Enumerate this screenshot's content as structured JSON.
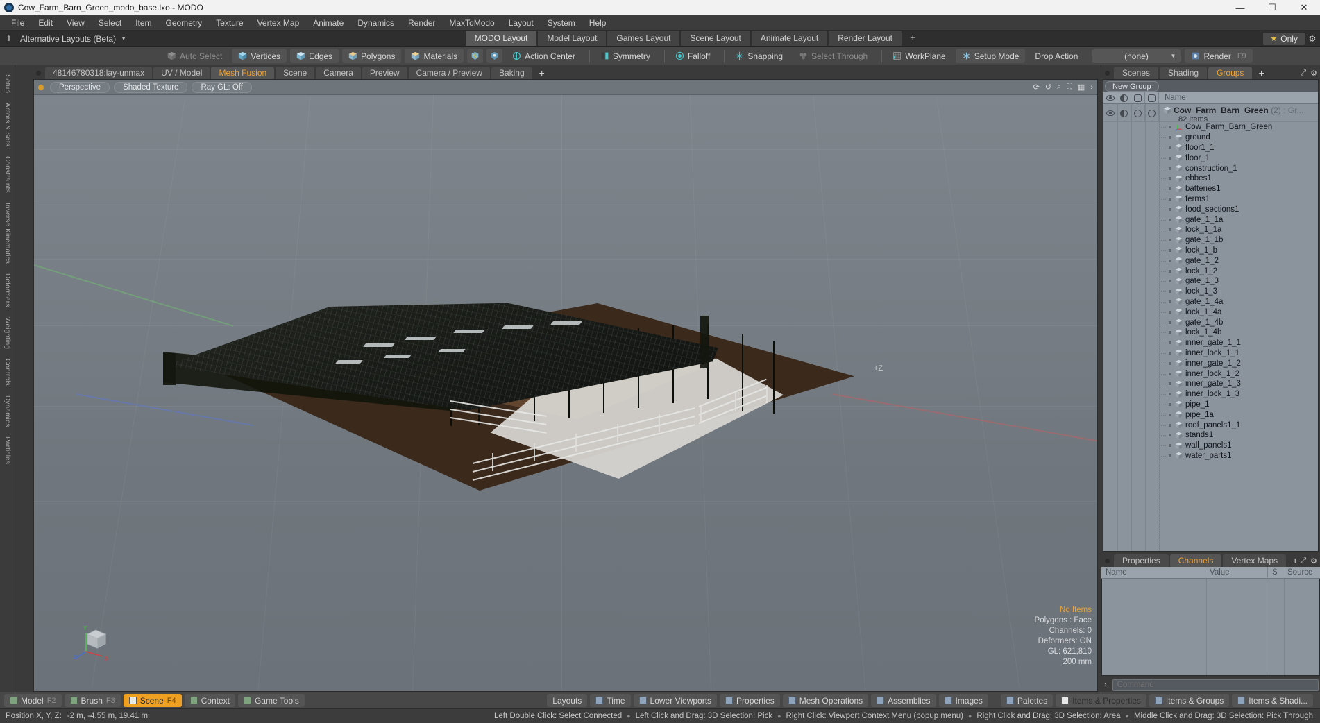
{
  "titlebar": {
    "title": "Cow_Farm_Barn_Green_modo_base.lxo - MODO",
    "app_icon": "modo-logo-icon",
    "minimize": "—",
    "maximize": "☐",
    "close": "✕"
  },
  "menubar": {
    "items": [
      "File",
      "Edit",
      "View",
      "Select",
      "Item",
      "Geometry",
      "Texture",
      "Vertex Map",
      "Animate",
      "Dynamics",
      "Render",
      "MaxToModo",
      "Layout",
      "System",
      "Help"
    ]
  },
  "layoutbar": {
    "alt_layouts": "Alternative Layouts (Beta)",
    "caret": "▼",
    "tabs": [
      {
        "label": "MODO Layout",
        "active": true
      },
      {
        "label": "Model Layout",
        "active": false
      },
      {
        "label": "Games Layout",
        "active": false
      },
      {
        "label": "Scene Layout",
        "active": false
      },
      {
        "label": "Animate Layout",
        "active": false
      },
      {
        "label": "Render Layout",
        "active": false
      }
    ],
    "add_tab": "+",
    "only_label": "Only",
    "star": "★",
    "gear": "⚙"
  },
  "toolbar": {
    "buttons": [
      {
        "label": "Auto Select",
        "disabled": true
      },
      {
        "label": "Vertices",
        "disabled": false
      },
      {
        "label": "Edges",
        "disabled": false
      },
      {
        "label": "Polygons",
        "disabled": false
      },
      {
        "label": "Materials",
        "disabled": false
      }
    ],
    "action_center": "Action Center",
    "symmetry": "Symmetry",
    "falloff": "Falloff",
    "snapping": "Snapping",
    "select_through": "Select Through",
    "workplane": "WorkPlane",
    "setup_mode": "Setup Mode",
    "drop_action_label": "Drop Action",
    "drop_action_value": "(none)",
    "render": "Render",
    "render_key": "F9"
  },
  "left_rail": {
    "items": [
      "Setup",
      "Actors & Sets",
      "Constraints",
      "Inverse Kinematics",
      "Deformers",
      "Weighting",
      "Controls",
      "Dynamics",
      "Particles"
    ]
  },
  "viewport": {
    "tabs": [
      {
        "label": "48146780318:lay-unmax",
        "active": false
      },
      {
        "label": "UV / Model",
        "active": false
      },
      {
        "label": "Mesh Fusion",
        "active": true
      },
      {
        "label": "Scene",
        "active": false
      },
      {
        "label": "Camera",
        "active": false
      },
      {
        "label": "Preview",
        "active": false
      },
      {
        "label": "Camera / Preview",
        "active": false
      },
      {
        "label": "Baking",
        "active": false
      }
    ],
    "add_tab": "+",
    "view_mode": "Perspective",
    "shading_mode": "Shaded Texture",
    "raygl": "Ray GL: Off",
    "axis_label": "+Z",
    "stats": {
      "no_items": "No Items",
      "polygons": "Polygons : Face",
      "channels": "Channels: 0",
      "deformers": "Deformers: ON",
      "gl": "GL: 621,810",
      "grid": "200 mm"
    },
    "gizmo": {
      "x": "X",
      "y": "Y",
      "z": "Z"
    }
  },
  "right_dock": {
    "tabs": [
      {
        "label": "Scenes",
        "active": false
      },
      {
        "label": "Shading",
        "active": false
      },
      {
        "label": "Groups",
        "active": true
      }
    ],
    "add_tab": "+",
    "new_group_button": "New Group",
    "columns": [
      "eye-icon",
      "shading-icon",
      "render-icon",
      "select-icon",
      "Name"
    ],
    "name_column": "Name",
    "group": {
      "name": "Cow_Farm_Barn_Green",
      "count": "(2)",
      "type": ": Gr...",
      "subtitle": "82 Items"
    },
    "items": [
      {
        "name": "Cow_Farm_Barn_Green",
        "icon": "locator-icon"
      },
      {
        "name": "ground",
        "icon": "mesh-icon"
      },
      {
        "name": "floor1_1",
        "icon": "mesh-icon"
      },
      {
        "name": "floor_1",
        "icon": "mesh-icon"
      },
      {
        "name": "construction_1",
        "icon": "mesh-icon"
      },
      {
        "name": "ebbes1",
        "icon": "mesh-icon"
      },
      {
        "name": "batteries1",
        "icon": "mesh-icon"
      },
      {
        "name": "ferms1",
        "icon": "mesh-icon"
      },
      {
        "name": "food_sections1",
        "icon": "mesh-icon"
      },
      {
        "name": "gate_1_1a",
        "icon": "mesh-icon"
      },
      {
        "name": "lock_1_1a",
        "icon": "mesh-icon"
      },
      {
        "name": "gate_1_1b",
        "icon": "mesh-icon"
      },
      {
        "name": "lock_1_b",
        "icon": "mesh-icon"
      },
      {
        "name": "gate_1_2",
        "icon": "mesh-icon"
      },
      {
        "name": "lock_1_2",
        "icon": "mesh-icon"
      },
      {
        "name": "gate_1_3",
        "icon": "mesh-icon"
      },
      {
        "name": "lock_1_3",
        "icon": "mesh-icon"
      },
      {
        "name": "gate_1_4a",
        "icon": "mesh-icon"
      },
      {
        "name": "lock_1_4a",
        "icon": "mesh-icon"
      },
      {
        "name": "gate_1_4b",
        "icon": "mesh-icon"
      },
      {
        "name": "lock_1_4b",
        "icon": "mesh-icon"
      },
      {
        "name": "inner_gate_1_1",
        "icon": "mesh-icon"
      },
      {
        "name": "inner_lock_1_1",
        "icon": "mesh-icon"
      },
      {
        "name": "inner_gate_1_2",
        "icon": "mesh-icon"
      },
      {
        "name": "inner_lock_1_2",
        "icon": "mesh-icon"
      },
      {
        "name": "inner_gate_1_3",
        "icon": "mesh-icon"
      },
      {
        "name": "inner_lock_1_3",
        "icon": "mesh-icon"
      },
      {
        "name": "pipe_1",
        "icon": "mesh-icon"
      },
      {
        "name": "pipe_1a",
        "icon": "mesh-icon"
      },
      {
        "name": "roof_panels1_1",
        "icon": "mesh-icon"
      },
      {
        "name": "stands1",
        "icon": "mesh-icon"
      },
      {
        "name": "wall_panels1",
        "icon": "mesh-icon"
      },
      {
        "name": "water_parts1",
        "icon": "mesh-icon"
      }
    ]
  },
  "bottom_dock": {
    "tabs": [
      {
        "label": "Properties",
        "active": false
      },
      {
        "label": "Channels",
        "active": true
      },
      {
        "label": "Vertex Maps",
        "active": false
      }
    ],
    "add_tab": "+",
    "columns": [
      "Name",
      "Value",
      "S",
      "Source"
    ],
    "command_placeholder": "Command",
    "command_caret": "›"
  },
  "modebar": {
    "left_buttons": [
      {
        "label": "Model",
        "fkey": "F2",
        "active": false
      },
      {
        "label": "Brush",
        "fkey": "F3",
        "active": false
      },
      {
        "label": "Scene",
        "fkey": "F4",
        "active": true
      },
      {
        "label": "Context",
        "fkey": "",
        "active": false
      },
      {
        "label": "Game Tools",
        "fkey": "",
        "active": false
      }
    ],
    "center_buttons": [
      {
        "label": "Layouts",
        "swatch": false
      },
      {
        "label": "Time",
        "swatch": true
      },
      {
        "label": "Lower Viewports",
        "swatch": true
      },
      {
        "label": "Properties",
        "swatch": true
      },
      {
        "label": "Mesh Operations",
        "swatch": true
      },
      {
        "label": "Assemblies",
        "swatch": true
      },
      {
        "label": "Images",
        "swatch": true
      }
    ],
    "right_buttons": [
      {
        "label": "Palettes",
        "active": false
      },
      {
        "label": "Items & Properties",
        "active": true
      },
      {
        "label": "Items & Groups",
        "active": false
      },
      {
        "label": "Items & Shadi...",
        "active": false
      }
    ]
  },
  "statusbar": {
    "position_label": "Position X, Y, Z:",
    "position_value": "-2 m, -4.55 m, 19.41 m",
    "hints": [
      "Left Double Click: Select Connected",
      "Left Click and Drag: 3D Selection: Pick",
      "Right Click: Viewport Context Menu (popup menu)",
      "Right Click and Drag: 3D Selection: Area",
      "Middle Click and Drag: 3D Selection: Pick Through"
    ],
    "hint_dot": "●"
  }
}
